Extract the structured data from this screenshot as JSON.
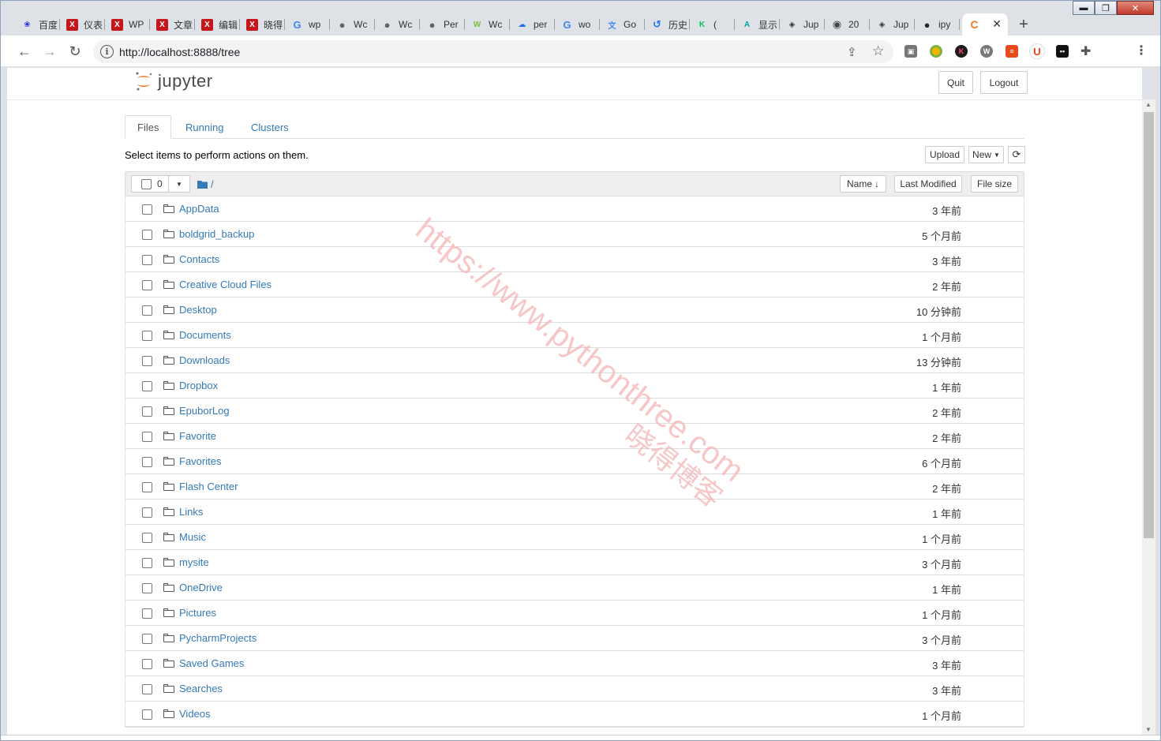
{
  "browser": {
    "tabs": [
      {
        "title": "百度",
        "icon": "paw-icon",
        "color": "#2932e1"
      },
      {
        "title": "仪表",
        "icon": "x-icon",
        "color": "#c4161c"
      },
      {
        "title": "WP",
        "icon": "x-icon",
        "color": "#c4161c"
      },
      {
        "title": "文章",
        "icon": "x-icon",
        "color": "#c4161c"
      },
      {
        "title": "编辑",
        "icon": "x-icon",
        "color": "#c4161c"
      },
      {
        "title": "晓得",
        "icon": "x-icon",
        "color": "#c4161c"
      },
      {
        "title": "wp",
        "icon": "google-icon",
        "color": "#4285f4"
      },
      {
        "title": "Wc",
        "icon": "globe-icon",
        "color": "#5f6368"
      },
      {
        "title": "Wc",
        "icon": "globe-icon",
        "color": "#5f6368"
      },
      {
        "title": "Per",
        "icon": "globe-icon",
        "color": "#5f6368"
      },
      {
        "title": "Wc",
        "icon": "wp-green-icon",
        "color": "#7ac142"
      },
      {
        "title": "per",
        "icon": "cloud-icon",
        "color": "#1a73e8"
      },
      {
        "title": "wo",
        "icon": "google-icon",
        "color": "#4285f4"
      },
      {
        "title": "Go",
        "icon": "translate-icon",
        "color": "#4285f4"
      },
      {
        "title": "历史",
        "icon": "history-icon",
        "color": "#1a73e8"
      },
      {
        "title": "(",
        "icon": "k-icon",
        "color": "#00c853"
      },
      {
        "title": "显示",
        "icon": "a-icon",
        "color": "#00a3a3"
      },
      {
        "title": "Jup",
        "icon": "diamond-icon",
        "color": "#333333"
      },
      {
        "title": "20",
        "icon": "drop-icon",
        "color": "#444444"
      },
      {
        "title": "Jup",
        "icon": "diamond-icon",
        "color": "#333333"
      },
      {
        "title": "ipy",
        "icon": "github-icon",
        "color": "#24292e"
      },
      {
        "title": "",
        "icon": "jupyter-icon",
        "color": "#f37726",
        "active": true
      }
    ],
    "url": "http://localhost:8888/tree",
    "window_controls": {
      "minimize": "▬",
      "maximize": "❐",
      "close": "✕"
    }
  },
  "app": {
    "logo_text": "jupyter",
    "quit_label": "Quit",
    "logout_label": "Logout",
    "nav_tabs": [
      "Files",
      "Running",
      "Clusters"
    ],
    "select_info": "Select items to perform actions on them.",
    "upload_label": "Upload",
    "new_label": "New",
    "selected_count": "0",
    "breadcrumb": "/",
    "columns": {
      "name": "Name",
      "last_modified": "Last Modified",
      "file_size": "File size"
    },
    "files": [
      {
        "name": "AppData",
        "modified": "3 年前"
      },
      {
        "name": "boldgrid_backup",
        "modified": "5 个月前"
      },
      {
        "name": "Contacts",
        "modified": "3 年前"
      },
      {
        "name": "Creative Cloud Files",
        "modified": "2 年前"
      },
      {
        "name": "Desktop",
        "modified": "10 分钟前"
      },
      {
        "name": "Documents",
        "modified": "1 个月前"
      },
      {
        "name": "Downloads",
        "modified": "13 分钟前"
      },
      {
        "name": "Dropbox",
        "modified": "1 年前"
      },
      {
        "name": "EpuborLog",
        "modified": "2 年前"
      },
      {
        "name": "Favorite",
        "modified": "2 年前"
      },
      {
        "name": "Favorites",
        "modified": "6 个月前"
      },
      {
        "name": "Flash Center",
        "modified": "2 年前"
      },
      {
        "name": "Links",
        "modified": "1 年前"
      },
      {
        "name": "Music",
        "modified": "1 个月前"
      },
      {
        "name": "mysite",
        "modified": "3 个月前"
      },
      {
        "name": "OneDrive",
        "modified": "1 年前"
      },
      {
        "name": "Pictures",
        "modified": "1 个月前"
      },
      {
        "name": "PycharmProjects",
        "modified": "3 个月前"
      },
      {
        "name": "Saved Games",
        "modified": "3 年前"
      },
      {
        "name": "Searches",
        "modified": "3 年前"
      },
      {
        "name": "Videos",
        "modified": "1 个月前"
      }
    ]
  },
  "watermark": {
    "line1": "https://www.pythonthree.com",
    "line2": "晓得博客"
  },
  "colors": {
    "link": "#337ab7",
    "jupyter_orange": "#f37726",
    "watermark": "#f5b5b5"
  }
}
